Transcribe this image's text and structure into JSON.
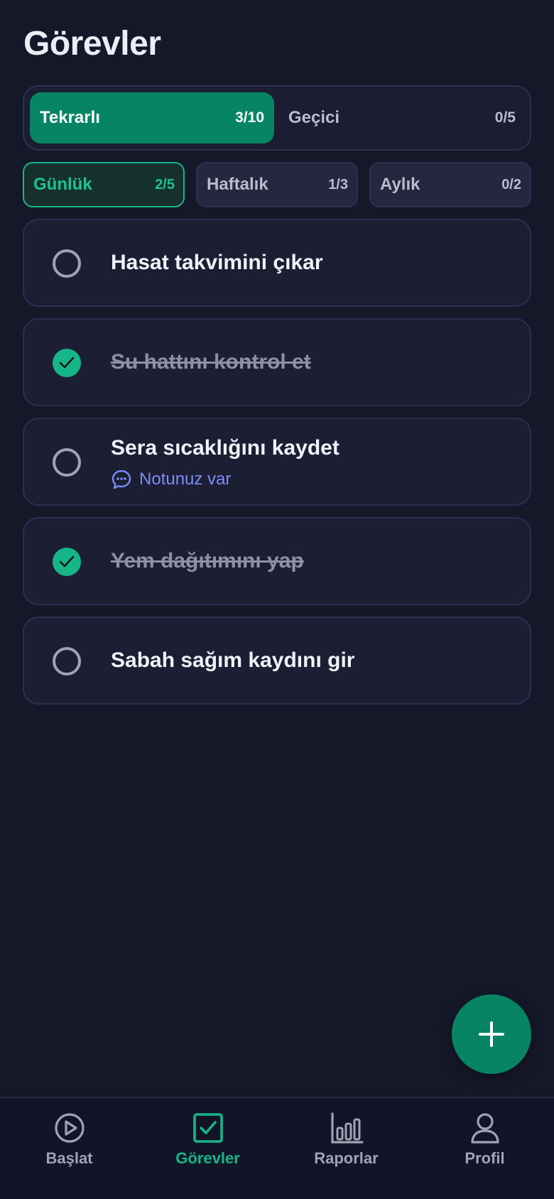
{
  "page": {
    "title": "Görevler"
  },
  "segments": [
    {
      "label": "Tekrarlı",
      "count": "3/10",
      "active": true
    },
    {
      "label": "Geçici",
      "count": "0/5",
      "active": false
    }
  ],
  "periods": [
    {
      "label": "Günlük",
      "count": "2/5",
      "active": true
    },
    {
      "label": "Haftalık",
      "count": "1/3",
      "active": false
    },
    {
      "label": "Aylık",
      "count": "0/2",
      "active": false
    }
  ],
  "tasks": [
    {
      "title": "Hasat takvimini çıkar",
      "done": false
    },
    {
      "title": "Su hattını kontrol et",
      "done": true
    },
    {
      "title": "Sera sıcaklığını kaydet",
      "done": false,
      "note": "Notunuz var",
      "note_icon": "chat-bubble-icon"
    },
    {
      "title": "Yem dağıtımını yap",
      "done": true
    },
    {
      "title": "Sabah sağım kaydını gir",
      "done": false
    }
  ],
  "fab": {
    "icon": "plus-icon"
  },
  "nav": [
    {
      "label": "Başlat",
      "icon": "play-circle-icon",
      "active": false
    },
    {
      "label": "Görevler",
      "icon": "checkbox-icon",
      "active": true
    },
    {
      "label": "Raporlar",
      "icon": "bar-chart-icon",
      "active": false
    },
    {
      "label": "Profil",
      "icon": "user-icon",
      "active": false
    }
  ],
  "colors": {
    "background": "#151829",
    "accent": "#078463",
    "accent_light": "#16b688",
    "note_link": "#7b8cf7",
    "muted": "#9fa3b4"
  }
}
